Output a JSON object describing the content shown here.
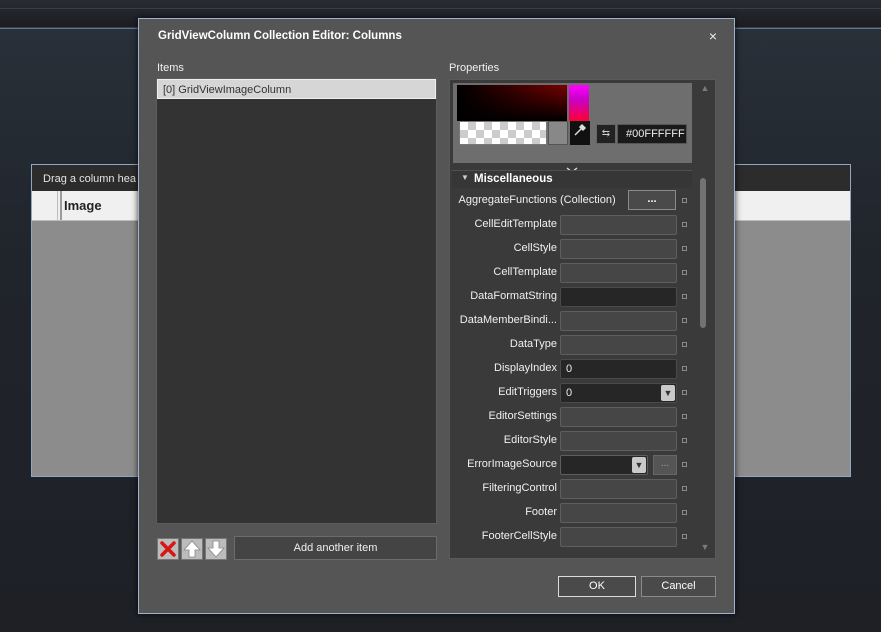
{
  "background_grid": {
    "header_text": "Drag a column hea",
    "column_header": "Image"
  },
  "dialog": {
    "title": "GridViewColumn Collection Editor: Columns",
    "close_glyph": "×",
    "items_label": "Items",
    "properties_label": "Properties",
    "items": [
      "[0] GridViewImageColumn"
    ],
    "add_button": "Add another item",
    "ok_button": "OK",
    "cancel_button": "Cancel"
  },
  "color_picker": {
    "hex_value": "#00FFFFFF"
  },
  "properties": {
    "category": "Miscellaneous",
    "rows": [
      {
        "name": "AggregateFunctions",
        "value": "(Collection)",
        "button": "..."
      },
      {
        "name": "CellEditTemplate",
        "value": ""
      },
      {
        "name": "CellStyle",
        "value": ""
      },
      {
        "name": "CellTemplate",
        "value": ""
      },
      {
        "name": "DataFormatString",
        "value": ""
      },
      {
        "name": "DataMemberBindi...",
        "value": ""
      },
      {
        "name": "DataType",
        "value": ""
      },
      {
        "name": "DisplayIndex",
        "value": "0"
      },
      {
        "name": "EditTriggers",
        "value": "0"
      },
      {
        "name": "EditorSettings",
        "value": ""
      },
      {
        "name": "EditorStyle",
        "value": ""
      },
      {
        "name": "ErrorImageSource",
        "value": "",
        "button": "..."
      },
      {
        "name": "FilteringControl",
        "value": ""
      },
      {
        "name": "Footer",
        "value": ""
      },
      {
        "name": "FooterCellStyle",
        "value": ""
      }
    ]
  },
  "icons": {
    "delete": "delete-icon",
    "move_up": "arrow-up-icon",
    "move_down": "arrow-down-icon"
  }
}
